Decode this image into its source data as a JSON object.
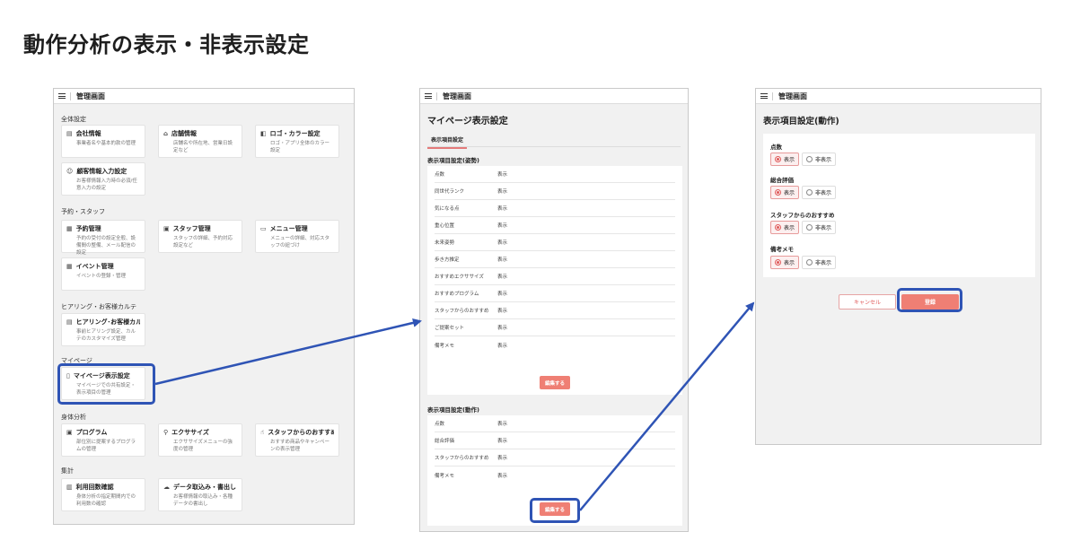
{
  "page_title": "動作分析の表示・非表示設定",
  "app_name": "管理画面",
  "screen1": {
    "sections": {
      "general": "全体設定",
      "reserve": "予約・スタッフ",
      "hearing": "ヒアリング・お客様カルテ",
      "mypage": "マイページ",
      "body": "身体分析",
      "stats": "集計"
    },
    "cards": {
      "company": {
        "title": "会社情報",
        "desc": "事業者名や基本的款の管理",
        "icon": "building-icon"
      },
      "store": {
        "title": "店舗情報",
        "desc": "店舗名や所在地、営業日設定など",
        "icon": "store-icon"
      },
      "logo": {
        "title": "ロゴ・カラー設定",
        "desc": "ロゴ・アプリ全体のカラー設定",
        "icon": "palette-icon"
      },
      "customer": {
        "title": "顧客情報入力設定",
        "desc": "お客様情報入力時の必須/任意入力の設定",
        "icon": "user-add-icon"
      },
      "reservation": {
        "title": "予約管理",
        "desc": "予約の受付の設定全般、設備間の整備、メール配信の設定",
        "icon": "calendar-icon"
      },
      "staff": {
        "title": "スタッフ管理",
        "desc": "スタッフの詳細、予約対応設定など",
        "icon": "staff-icon"
      },
      "menu": {
        "title": "メニュー管理",
        "desc": "メニューの詳細、対応スタッフの紐づけ",
        "icon": "monitor-icon"
      },
      "event": {
        "title": "イベント管理",
        "desc": "イベントの登録・管理",
        "icon": "calendar-icon"
      },
      "hearingkarte": {
        "title": "ヒアリング･お客様カルテ",
        "desc": "事前ヒアリング設定、カルテのカスタマイズ管理",
        "icon": "clipboard-icon"
      },
      "mypageset": {
        "title": "マイページ表示設定",
        "desc": "マイページでの共有設定・表示項目の管理",
        "icon": "phone-icon"
      },
      "program": {
        "title": "プログラム",
        "desc": "部位別に提案するプログラムの管理",
        "icon": "program-icon"
      },
      "exercise": {
        "title": "エクササイズ",
        "desc": "エクササイズメニューの強度の管理",
        "icon": "exercise-icon"
      },
      "recommend": {
        "title": "スタッフからのおすすめ",
        "desc": "おすすめ商品やキャンペーンの表示管理",
        "icon": "thumbs-up-icon"
      },
      "usage": {
        "title": "利用回数確認",
        "desc": "身体分析の指定期間内での利用数の確認",
        "icon": "chart-icon"
      },
      "data": {
        "title": "データ取込み・書出し",
        "desc": "お客様情報の取込み・各種データの書出し",
        "icon": "cloud-icon"
      }
    }
  },
  "screen2": {
    "title": "マイページ表示設定",
    "tab": "表示項目設定",
    "posture_header": "表示項目設定(姿勢)",
    "posture_rows": [
      {
        "k": "点数",
        "v": "表示"
      },
      {
        "k": "同世代ランク",
        "v": "表示"
      },
      {
        "k": "気になる点",
        "v": "表示"
      },
      {
        "k": "重心位置",
        "v": "表示"
      },
      {
        "k": "未来姿勢",
        "v": "表示"
      },
      {
        "k": "歩き方推定",
        "v": "表示"
      },
      {
        "k": "おすすめエクササイズ",
        "v": "表示"
      },
      {
        "k": "おすすめプログラム",
        "v": "表示"
      },
      {
        "k": "スタッフからのおすすめ",
        "v": "表示"
      },
      {
        "k": "ご提案セット",
        "v": "表示"
      },
      {
        "k": "備考メモ",
        "v": "表示"
      }
    ],
    "edit_label": "編集する",
    "motion_header": "表示項目設定(動作)",
    "motion_rows": [
      {
        "k": "点数",
        "v": "表示"
      },
      {
        "k": "総合評価",
        "v": "表示"
      },
      {
        "k": "スタッフからのおすすめ",
        "v": "表示"
      },
      {
        "k": "備考メモ",
        "v": "表示"
      }
    ]
  },
  "screen3": {
    "title": "表示項目設定(動作)",
    "fields": [
      {
        "label": "点数",
        "show": "表示",
        "hide": "非表示"
      },
      {
        "label": "総合評価",
        "show": "表示",
        "hide": "非表示"
      },
      {
        "label": "スタッフからのおすすめ",
        "show": "表示",
        "hide": "非表示"
      },
      {
        "label": "備考メモ",
        "show": "表示",
        "hide": "非表示"
      }
    ],
    "cancel": "キャンセル",
    "submit": "登録"
  },
  "colors": {
    "accent": "#ef7f74",
    "highlight": "#2f54b5"
  }
}
